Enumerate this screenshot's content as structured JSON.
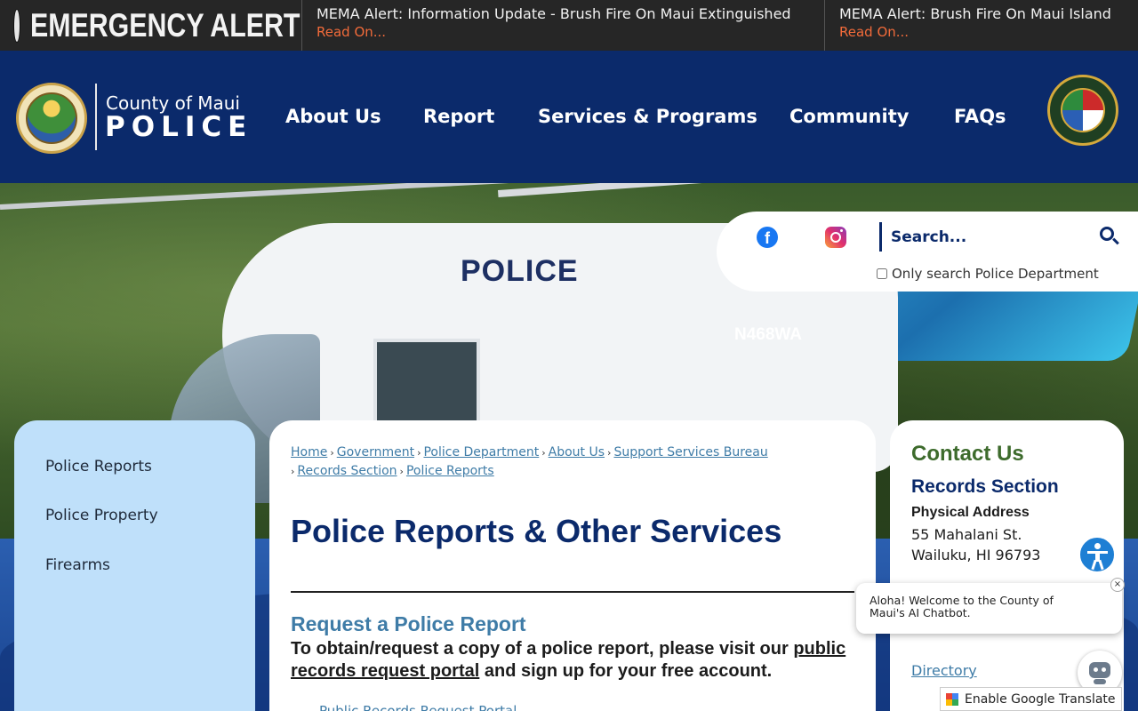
{
  "alert": {
    "title": "EMERGENCY ALERT",
    "items": [
      {
        "text": "MEMA Alert: Information Update - Brush Fire On Maui Extinguished",
        "link": "Read On..."
      },
      {
        "text": "MEMA Alert: Brush Fire On Maui Island",
        "link": "Read On..."
      }
    ]
  },
  "logo": {
    "county": "County of Maui",
    "police": "POLICE"
  },
  "nav": [
    "About Us",
    "Report",
    "Services & Programs",
    "Community",
    "FAQs"
  ],
  "hero": {
    "heli_text": "POLICE",
    "heli_reg": "N468WA"
  },
  "search": {
    "placeholder": "Search...",
    "only_label": "Only search Police Department"
  },
  "sidebar": {
    "items": [
      "Police Reports",
      "Police Property",
      "Firearms"
    ]
  },
  "breadcrumb": [
    "Home",
    "Government",
    "Police Department",
    "About Us",
    "Support Services Bureau",
    "Records Section",
    "Police Reports"
  ],
  "main": {
    "title": "Police Reports & Other Services",
    "section_head": "Request a Police Report",
    "body_pre": "To obtain/request a copy of a police report, please visit our ",
    "body_link": "public records request portal",
    "body_post": " and sign up for your free account.",
    "sub_link": "Public Records Request Portal"
  },
  "contact": {
    "title": "Contact Us",
    "section": "Records Section",
    "label": "Physical Address",
    "address1": "55 Mahalani St.",
    "address2": "Wailuku, HI 96793",
    "directory": "Directory"
  },
  "chat": {
    "message": "Aloha! Welcome to the County of Maui's AI Chatbot.",
    "close": "×"
  },
  "translate": {
    "label": "Enable Google Translate"
  },
  "colors": {
    "navy": "#0b2a6b",
    "alert_link": "#f26b3a",
    "link_blue": "#3f7ca7",
    "contact_green": "#3d6b2c",
    "sidebar_bg": "#bfe0fa"
  }
}
